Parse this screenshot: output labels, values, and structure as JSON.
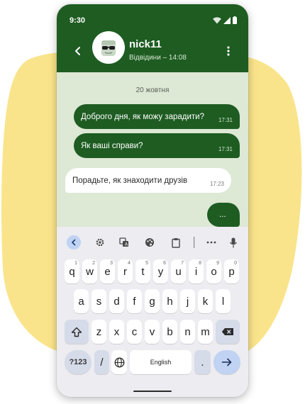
{
  "status": {
    "time": "9:30",
    "icons": [
      "wifi-icon",
      "signal-icon",
      "battery-icon"
    ]
  },
  "header": {
    "contact_name": "nick11",
    "contact_status": "Відвідини – 14:08"
  },
  "chat": {
    "date": "20 жовтня",
    "messages": [
      {
        "direction": "out",
        "text": "Доброго дня, як можу зарадити?",
        "time": "17:31"
      },
      {
        "direction": "out",
        "text": "Як ваші справи?",
        "time": "17:31"
      },
      {
        "direction": "in",
        "text": "Порадьте, як знаходити друзів",
        "time": "17:23"
      },
      {
        "direction": "out",
        "text": "...",
        "time": ""
      }
    ]
  },
  "keyboard": {
    "toolbar": [
      "collapse-icon",
      "settings-icon",
      "translate-icon",
      "palette-icon",
      "clipboard-icon",
      "more-icon",
      "mic-icon"
    ],
    "row1": [
      {
        "key": "q",
        "hint": "1"
      },
      {
        "key": "w",
        "hint": "2"
      },
      {
        "key": "e",
        "hint": "3"
      },
      {
        "key": "r",
        "hint": "4"
      },
      {
        "key": "t",
        "hint": "5"
      },
      {
        "key": "y",
        "hint": "6"
      },
      {
        "key": "u",
        "hint": "7"
      },
      {
        "key": "i",
        "hint": "8"
      },
      {
        "key": "o",
        "hint": "9"
      },
      {
        "key": "p",
        "hint": "0"
      }
    ],
    "row2": [
      "a",
      "s",
      "d",
      "f",
      "g",
      "h",
      "j",
      "k",
      "l"
    ],
    "row3": [
      "z",
      "x",
      "c",
      "v",
      "b",
      "n",
      "m"
    ],
    "symbols_label": "?123",
    "slash_label": "/",
    "space_label": "English",
    "period_label": "."
  },
  "colors": {
    "primary": "#1e5c22",
    "chat_bg": "#dde8d5",
    "accent_key": "#c0d3f3",
    "blob": "#fae48b"
  }
}
